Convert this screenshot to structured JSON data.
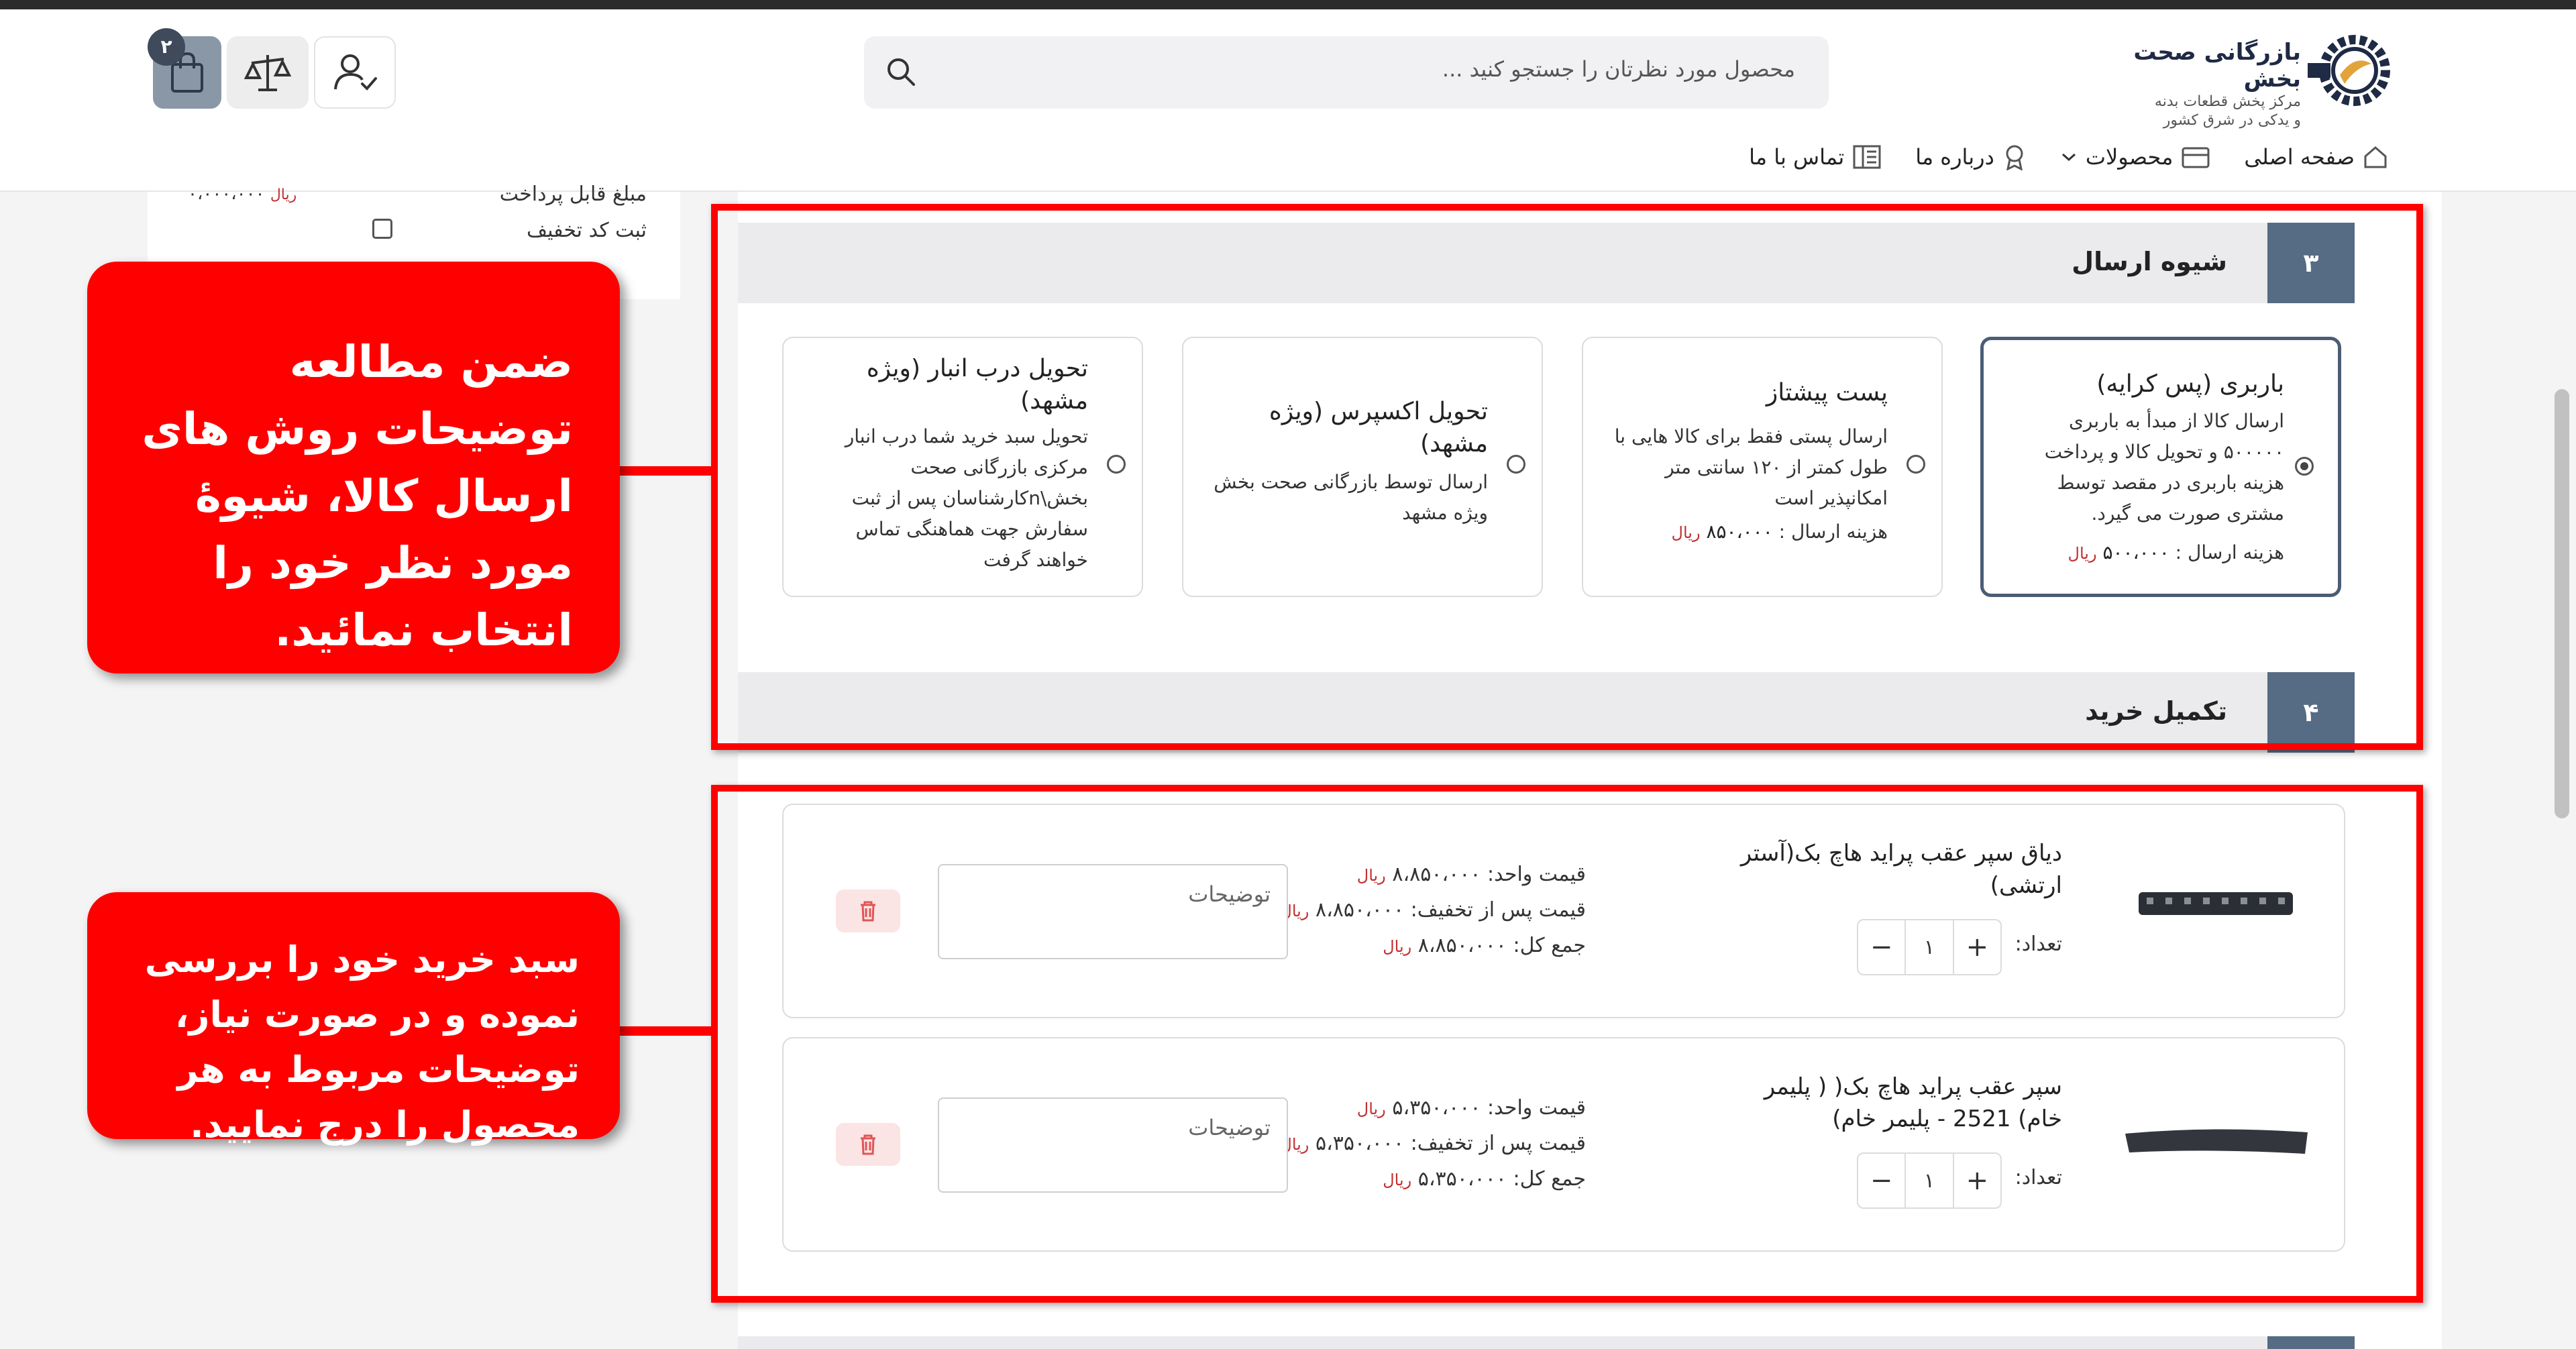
{
  "header": {
    "logo": {
      "name": "بازرگانی صحت بخش",
      "tagline_1": "مرکز پخش قطعات بدنه",
      "tagline_2": "و یدکی در شرق کشور"
    },
    "search": {
      "placeholder": "محصول مورد نظرتان را جستجو کنید ..."
    },
    "cart_badge": "۲",
    "nav": [
      {
        "label": "صفحه اصلی",
        "icon": "home-icon"
      },
      {
        "label": "محصولات",
        "icon": "box-icon"
      },
      {
        "label": "درباره ما",
        "icon": "award-icon"
      },
      {
        "label": "تماس با ما",
        "icon": "building-icon"
      }
    ]
  },
  "sidebar_fragment": {
    "payable_label": "مبلغ قابل پرداخت",
    "payable_amount": "۰،۰۰۰،۰۰۰",
    "payable_currency": "ریال",
    "discount_label": "ثبت کد تخفیف"
  },
  "shipping_section": {
    "step": "۳",
    "title": "شیوه ارسال",
    "options": [
      {
        "title": "باربری (پس کرایه)",
        "description": "ارسال کالا از مبدأ به باربری ۵۰۰۰۰۰ و تحویل کالا و پرداخت هزینه باربری در مقصد توسط مشتری صورت می گیرد.",
        "cost_label": "هزینه ارسال :",
        "cost": "۵۰۰،۰۰۰",
        "currency": "ریال",
        "selected": true
      },
      {
        "title": "پست پیشتاز",
        "description": "ارسال پستی فقط برای کالا هایی با طول کمتر از ۱۲۰ سانتی متر امکانپذیر است",
        "cost_label": "هزینه ارسال :",
        "cost": "۸۵۰،۰۰۰",
        "currency": "ریال",
        "selected": false
      },
      {
        "title": "تحویل اکسپرس (ویژه مشهد)",
        "description": "ارسال توسط بازرگانی صحت بخش ویژه مشهد",
        "selected": false
      },
      {
        "title": "تحویل درب انبار (ویژه مشهد)",
        "description": "تحویل سبد خرید شما درب انبار مرکزی بازرگانی صحت بخش\\nکارشناسان پس از ثبت سفارش جهت هماهنگی تماس خواهند گرفت",
        "selected": false
      }
    ]
  },
  "checkout_section": {
    "step": "۴",
    "title": "تکمیل خرید"
  },
  "cart": {
    "unit_price_label": "قیمت واحد:",
    "discounted_label": "قیمت پس از تخفیف:",
    "total_label": "جمع کل:",
    "currency": "ریال",
    "qty_label": "تعداد:",
    "notes_placeholder": "توضیحات",
    "items": [
      {
        "title": "دیاق سپر عقب پراید هاچ بک(آستر ارتشی)",
        "unit_price": "۸،۸۵۰،۰۰۰",
        "discounted": "۸،۸۵۰،۰۰۰",
        "total": "۸،۸۵۰،۰۰۰",
        "qty": "۱"
      },
      {
        "title": "سپر عقب پراید هاچ بک( ( پلیمر خام) 2521 - پلیمر خام)",
        "unit_price": "۵،۳۵۰،۰۰۰",
        "discounted": "۵،۳۵۰،۰۰۰",
        "total": "۵،۳۵۰،۰۰۰",
        "qty": "۱"
      }
    ]
  },
  "callouts": {
    "shipping": "ضمن مطالعه توضیحات روش های ارسال کالا، شیوۀ مورد نظر خود را انتخاب نمائید.",
    "cart": "سبد خرید خود را بررسی نموده و در صورت نیاز، توضیحات مربوط به هر محصول را درج نمایید."
  },
  "colors": {
    "accent": "#566b84",
    "highlight": "#ff0000",
    "price_currency": "#c23030"
  }
}
